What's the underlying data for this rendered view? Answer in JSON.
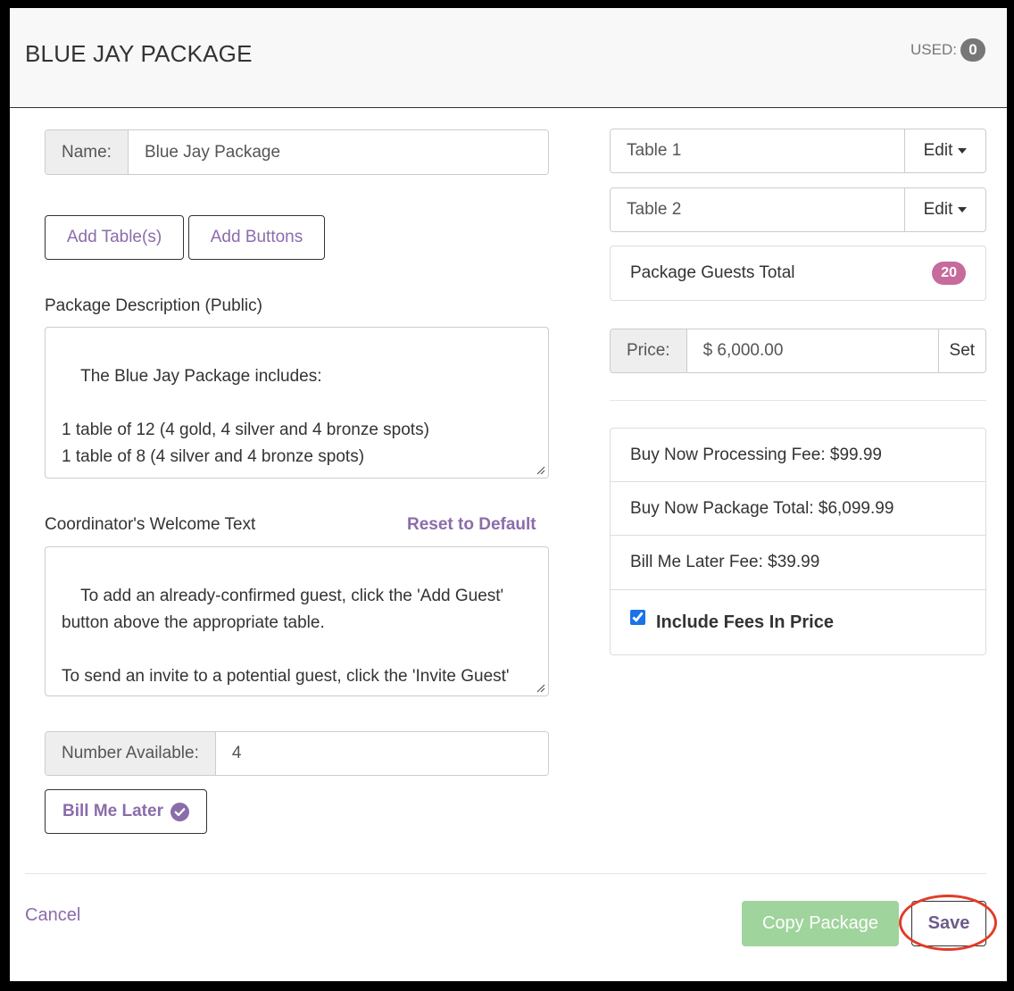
{
  "header": {
    "title": "BLUE JAY PACKAGE",
    "used_label": "USED:",
    "used_count": "0"
  },
  "form": {
    "name_label": "Name:",
    "name_value": "Blue Jay Package",
    "add_tables_button": "Add Table(s)",
    "add_buttons_button": "Add Buttons",
    "description_label": "Package Description (Public)",
    "description_text": "The Blue Jay Package includes:\n\n1 table of 12 (4 gold, 4 silver and 4 bronze spots)\n1 table of 8 (4 silver and 4 bronze spots)",
    "welcome_label": "Coordinator's Welcome Text",
    "reset_link": "Reset to Default",
    "welcome_text": "To add an already-confirmed guest, click the 'Add Guest' button above the appropriate table.\n\nTo send an invite to a potential guest, click the 'Invite Guest' button above the appropriate table. The guest will receive an invite email for a new seat (or guest / ...",
    "number_available_label": "Number Available:",
    "number_available_value": "4",
    "bill_me_later_button": "Bill Me Later"
  },
  "tables": [
    {
      "name": "Table 1",
      "edit_label": "Edit"
    },
    {
      "name": "Table 2",
      "edit_label": "Edit"
    }
  ],
  "guests_total": {
    "label": "Package Guests Total",
    "count": "20"
  },
  "price": {
    "label": "Price:",
    "value": "$ 6,000.00",
    "set_label": "Set"
  },
  "fees": {
    "processing_fee": "Buy Now Processing Fee: $99.99",
    "package_total": "Buy Now Package Total: $6,099.99",
    "bill_later_fee": "Bill Me Later Fee: $39.99",
    "include_fees_label": "Include Fees In Price",
    "include_fees_checked": true
  },
  "footer": {
    "cancel": "Cancel",
    "copy_package": "Copy Package",
    "save": "Save"
  },
  "colors": {
    "accent": "#8b6cab",
    "badge_pink": "#c66b9b",
    "success": "#9fd49c",
    "highlight": "#e23c28"
  }
}
